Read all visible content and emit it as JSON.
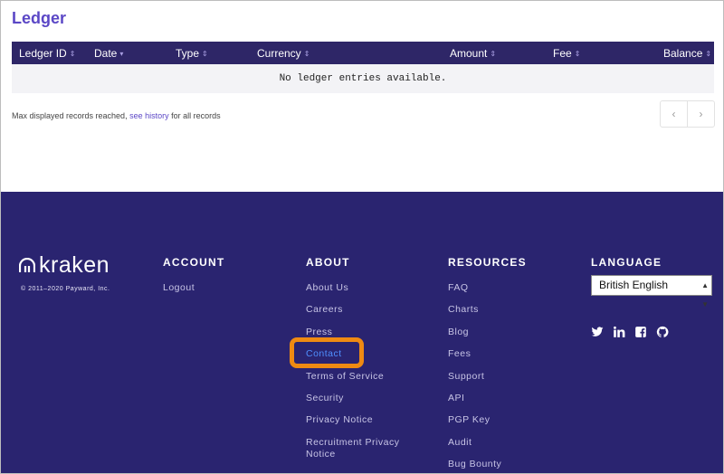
{
  "page": {
    "title": "Ledger"
  },
  "table": {
    "columns": [
      {
        "label": "Ledger ID",
        "sort": "⇕"
      },
      {
        "label": "Date",
        "sort": "▾"
      },
      {
        "label": "Type",
        "sort": "⇕"
      },
      {
        "label": "Currency",
        "sort": "⇕"
      },
      {
        "label": "Amount",
        "sort": "⇕"
      },
      {
        "label": "Fee",
        "sort": "⇕"
      },
      {
        "label": "Balance",
        "sort": "⇕"
      }
    ],
    "empty_message": "No ledger entries available."
  },
  "max_note": {
    "prefix": "Max displayed records reached, ",
    "link": "see history",
    "suffix": " for all records"
  },
  "pager": {
    "prev": "‹",
    "next": "›"
  },
  "footer": {
    "brand": "kraken",
    "copyright": "© 2011–2020 Payward, Inc.",
    "account": {
      "title": "ACCOUNT",
      "items": [
        "Logout"
      ]
    },
    "about": {
      "title": "ABOUT",
      "items": [
        "About Us",
        "Careers",
        "Press",
        "Contact",
        "Terms of Service",
        "Security",
        "Privacy Notice",
        "Recruitment Privacy Notice"
      ]
    },
    "resources": {
      "title": "RESOURCES",
      "items": [
        "FAQ",
        "Charts",
        "Blog",
        "Fees",
        "Support",
        "API",
        "PGP Key",
        "Audit",
        "Bug Bounty"
      ]
    },
    "language": {
      "title": "LANGUAGE",
      "selected": "British English"
    },
    "social_icons": [
      "twitter-icon",
      "linkedin-icon",
      "facebook-icon",
      "github-icon"
    ],
    "colors": {
      "background": "#2a2470",
      "accent": "#5b47c6",
      "highlight": "#ef8a12"
    }
  }
}
